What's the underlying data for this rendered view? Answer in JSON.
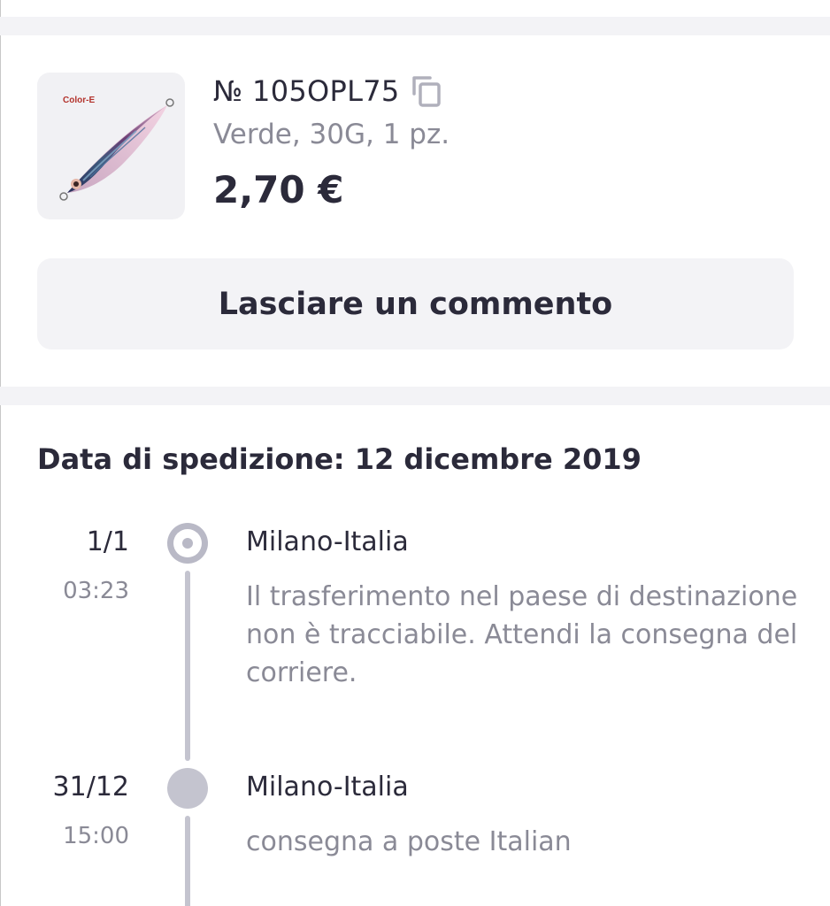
{
  "product": {
    "image_caption": "Color-E",
    "order_number": "№ 105OPL75",
    "variant": "Verde, 30G, 1 pz.",
    "price": "2,70 €",
    "copy_icon": "copy-icon"
  },
  "actions": {
    "comment_label": "Lasciare un commento"
  },
  "shipping": {
    "date_label": "Data di spedizione: 12 dicembre 2019"
  },
  "timeline": [
    {
      "date": "1/1",
      "time": "03:23",
      "location": "Milano-Italia",
      "description": "Il trasferimento nel paese di destinazione non è tracciabile. Attendi la consegna del corriere.",
      "current": true
    },
    {
      "date": "31/12",
      "time": "15:00",
      "location": "Milano-Italia",
      "description": "consegna a poste Italian",
      "current": false
    }
  ],
  "colors": {
    "text_primary": "#2b2a3a",
    "text_secondary": "#8a8a96",
    "surface": "#f3f3f6",
    "timeline": "#c4c4cf"
  }
}
